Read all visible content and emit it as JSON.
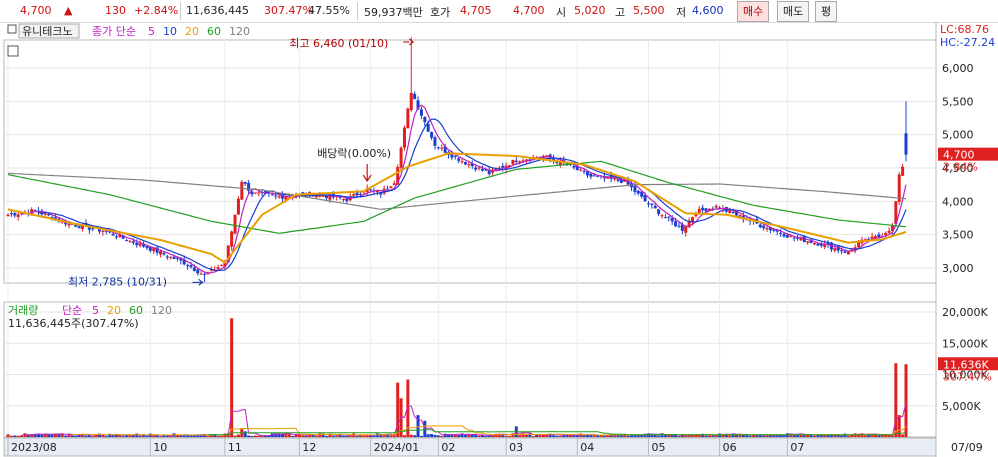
{
  "quote_bar": {
    "price": "4,700",
    "change": "130",
    "change_pct": "+2.84%",
    "volume": "11,636,445",
    "vol_ratio": "307.47%",
    "turnover": "47.55%",
    "amount": "59,937백만",
    "ask_label": "호가",
    "ask": "4,705",
    "bid": "4,700",
    "open_label": "시",
    "open": "5,020",
    "high_label": "고",
    "high": "5,500",
    "low_label": "저",
    "low": "4,600",
    "buy_button": "매수",
    "sell_button": "매도",
    "eval_button": "평"
  },
  "colors": {
    "up": "#e02020",
    "down": "#1a3fd0",
    "ma5": "#c020c0",
    "ma10": "#1a3fd0",
    "ma20": "#e8a000",
    "ma60": "#20a020",
    "ma120": "#808080"
  },
  "chart_data": [
    {
      "type": "candlestick",
      "title": "유니테크노",
      "legend": {
        "prefix": "종가 단순",
        "periods": [
          "5",
          "10",
          "20",
          "60",
          "120"
        ]
      },
      "ylim": [
        2700,
        6500
      ],
      "yticks": [
        "3,000",
        "3,500",
        "4,000",
        "4,500",
        "5,000",
        "5,500",
        "6,000"
      ],
      "ytick_values": [
        3000,
        3500,
        4000,
        4500,
        5000,
        5500,
        6000
      ],
      "xticks": [
        "2023/08",
        "10",
        "11",
        "12",
        "2024/01",
        "02",
        "03",
        "04",
        "05",
        "06",
        "07",
        "07/09"
      ],
      "lc": "LC:68.76",
      "hc": "HC:-27.24",
      "last_price_label": "4,700",
      "last_pct_label": "2.84%",
      "last_price": 4700,
      "annotations": {
        "high": "최고 6,460 (01/10)",
        "low": "최저 2,785 (10/31)",
        "dividend": "배당락(0.00%)"
      },
      "anchors": [
        [
          0,
          3800
        ],
        [
          8,
          3860
        ],
        [
          18,
          3660
        ],
        [
          28,
          3560
        ],
        [
          40,
          3330
        ],
        [
          52,
          3080
        ],
        [
          58,
          2890
        ],
        [
          64,
          3080
        ],
        [
          66,
          3550
        ],
        [
          69,
          4310
        ],
        [
          72,
          4120
        ],
        [
          80,
          4070
        ],
        [
          90,
          4110
        ],
        [
          100,
          4030
        ],
        [
          106,
          4180
        ],
        [
          110,
          4120
        ],
        [
          114,
          4300
        ],
        [
          116,
          4800
        ],
        [
          119,
          5650
        ],
        [
          122,
          5300
        ],
        [
          126,
          4850
        ],
        [
          130,
          4720
        ],
        [
          135,
          4580
        ],
        [
          142,
          4420
        ],
        [
          150,
          4620
        ],
        [
          158,
          4680
        ],
        [
          166,
          4520
        ],
        [
          172,
          4370
        ],
        [
          182,
          4300
        ],
        [
          188,
          4000
        ],
        [
          194,
          3760
        ],
        [
          199,
          3580
        ],
        [
          203,
          3840
        ],
        [
          209,
          3920
        ],
        [
          214,
          3820
        ],
        [
          222,
          3640
        ],
        [
          232,
          3450
        ],
        [
          240,
          3360
        ],
        [
          248,
          3230
        ],
        [
          251,
          3380
        ],
        [
          257,
          3470
        ],
        [
          261,
          3620
        ],
        [
          263,
          4370
        ],
        [
          265,
          4700
        ]
      ],
      "ma_anchors": {
        "ma20": [
          [
            0,
            3880
          ],
          [
            20,
            3660
          ],
          [
            45,
            3420
          ],
          [
            60,
            3210
          ],
          [
            64,
            3080
          ],
          [
            75,
            3800
          ],
          [
            85,
            4100
          ],
          [
            105,
            4150
          ],
          [
            118,
            4520
          ],
          [
            130,
            4720
          ],
          [
            150,
            4680
          ],
          [
            170,
            4550
          ],
          [
            185,
            4300
          ],
          [
            200,
            3820
          ],
          [
            212,
            3800
          ],
          [
            230,
            3600
          ],
          [
            248,
            3380
          ],
          [
            258,
            3430
          ],
          [
            265,
            3540
          ]
        ],
        "ma60": [
          [
            0,
            4400
          ],
          [
            30,
            4100
          ],
          [
            60,
            3700
          ],
          [
            80,
            3520
          ],
          [
            105,
            3700
          ],
          [
            120,
            4050
          ],
          [
            150,
            4480
          ],
          [
            175,
            4600
          ],
          [
            195,
            4280
          ],
          [
            220,
            3940
          ],
          [
            245,
            3720
          ],
          [
            265,
            3620
          ]
        ],
        "ma120": [
          [
            0,
            4420
          ],
          [
            40,
            4320
          ],
          [
            75,
            4170
          ],
          [
            110,
            3880
          ],
          [
            150,
            4080
          ],
          [
            185,
            4250
          ],
          [
            210,
            4260
          ],
          [
            240,
            4150
          ],
          [
            265,
            4040
          ]
        ]
      },
      "n_candles": 266
    },
    {
      "type": "bar",
      "title": "거래량",
      "legend": {
        "prefix": "단순",
        "periods": [
          "5",
          "20",
          "60",
          "120"
        ]
      },
      "subtitle": "11,636,445주(307.47%)",
      "ylim": [
        0,
        20000000
      ],
      "yticks": [
        "5,000K",
        "10,000K",
        "15,000K",
        "20,000K"
      ],
      "ytick_values": [
        5000000,
        10000000,
        15000000,
        20000000
      ],
      "last_value_label": "11,636K",
      "last_pct_label": "307.47%",
      "spikes": [
        [
          66,
          19000000
        ],
        [
          69,
          1400000
        ],
        [
          70,
          900000
        ],
        [
          115,
          8700000
        ],
        [
          116,
          6200000
        ],
        [
          118,
          9200000
        ],
        [
          121,
          3500000
        ],
        [
          123,
          2600000
        ],
        [
          150,
          1700000
        ],
        [
          262,
          11800000
        ],
        [
          263,
          3500000
        ],
        [
          265,
          11636445
        ]
      ]
    }
  ]
}
